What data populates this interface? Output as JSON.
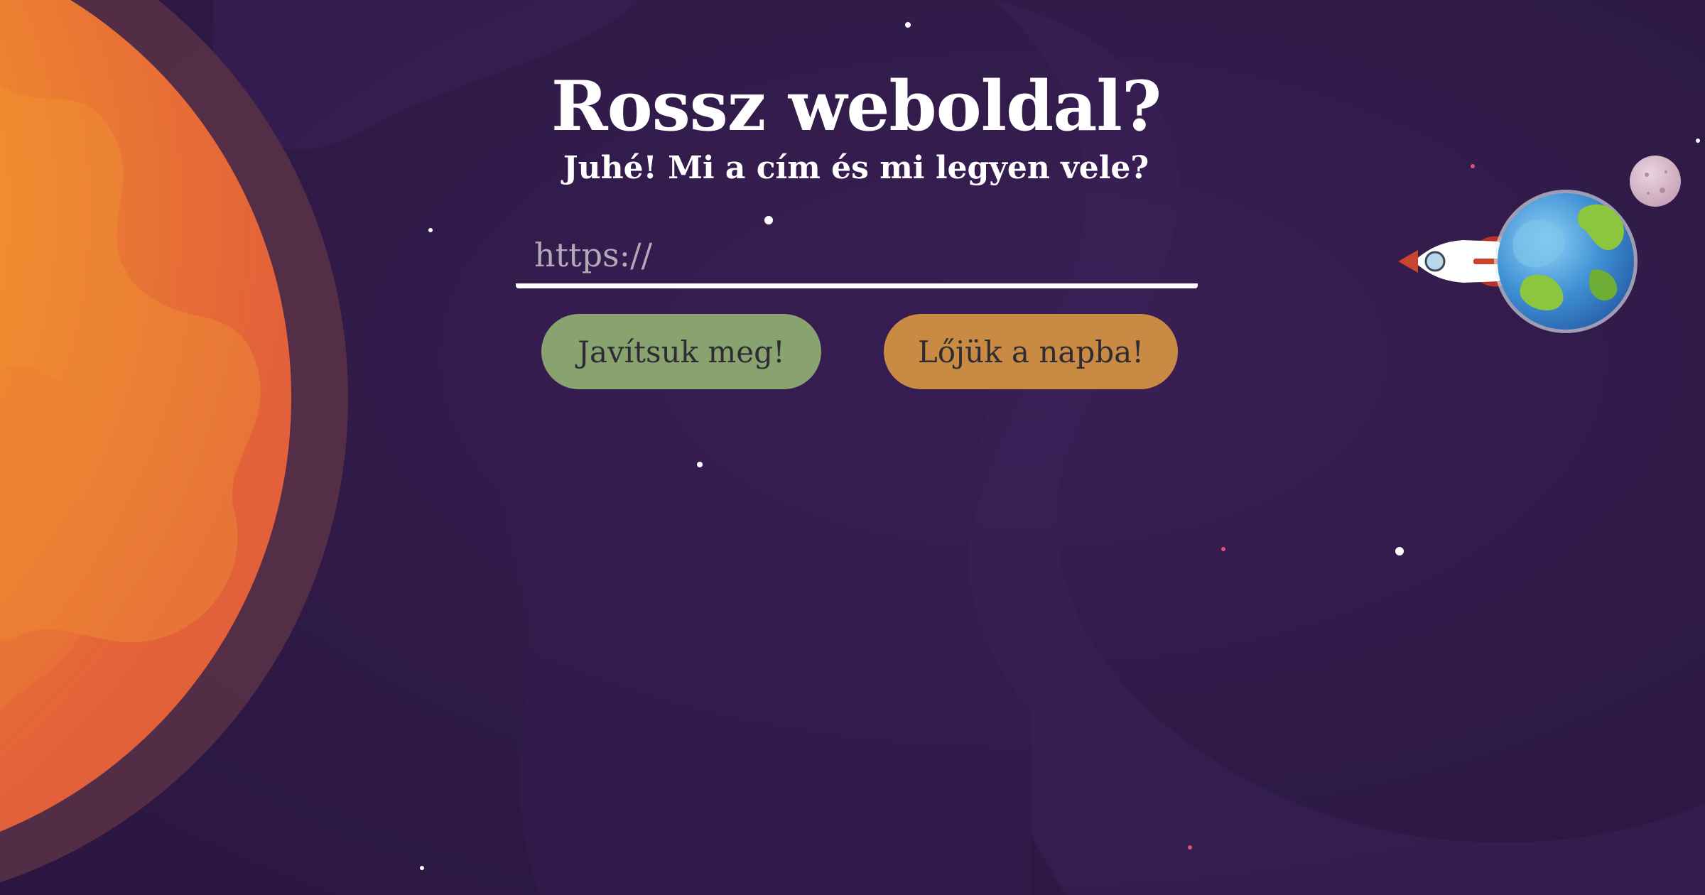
{
  "header": {
    "title": "Rossz weboldal?",
    "subtitle": "Juhé! Mi a cím és mi legyen vele?"
  },
  "url_input": {
    "placeholder": "https://",
    "value": ""
  },
  "actions": {
    "fix_label": "Javítsuk meg!",
    "sun_label": "Lőjük a napba!"
  },
  "colors": {
    "background": "#2f1a47",
    "fix_button": "#88a36f",
    "sun_button": "#c98a43",
    "sun": "#f08a2e",
    "earth_ocean": "#3f8fd4",
    "earth_land": "#8cc63f"
  },
  "illustration": {
    "icons": [
      "sun-icon",
      "earth-icon",
      "moon-icon",
      "rocket-icon",
      "star-icon"
    ]
  }
}
